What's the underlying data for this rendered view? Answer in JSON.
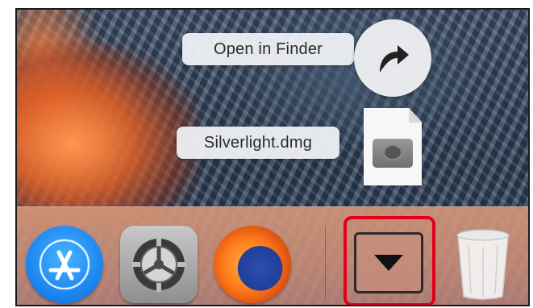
{
  "popup": {
    "open_in_finder_label": "Open in Finder",
    "file_name": "Silverlight.dmg"
  },
  "dock": {
    "items": [
      {
        "icon": "app-store-icon"
      },
      {
        "icon": "system-preferences-icon"
      },
      {
        "icon": "firefox-icon"
      },
      {
        "icon": "downloads-stack-icon"
      },
      {
        "icon": "trash-icon"
      }
    ]
  },
  "colors": {
    "highlight": "#e0001b",
    "pill_bg": "#eceef3"
  }
}
